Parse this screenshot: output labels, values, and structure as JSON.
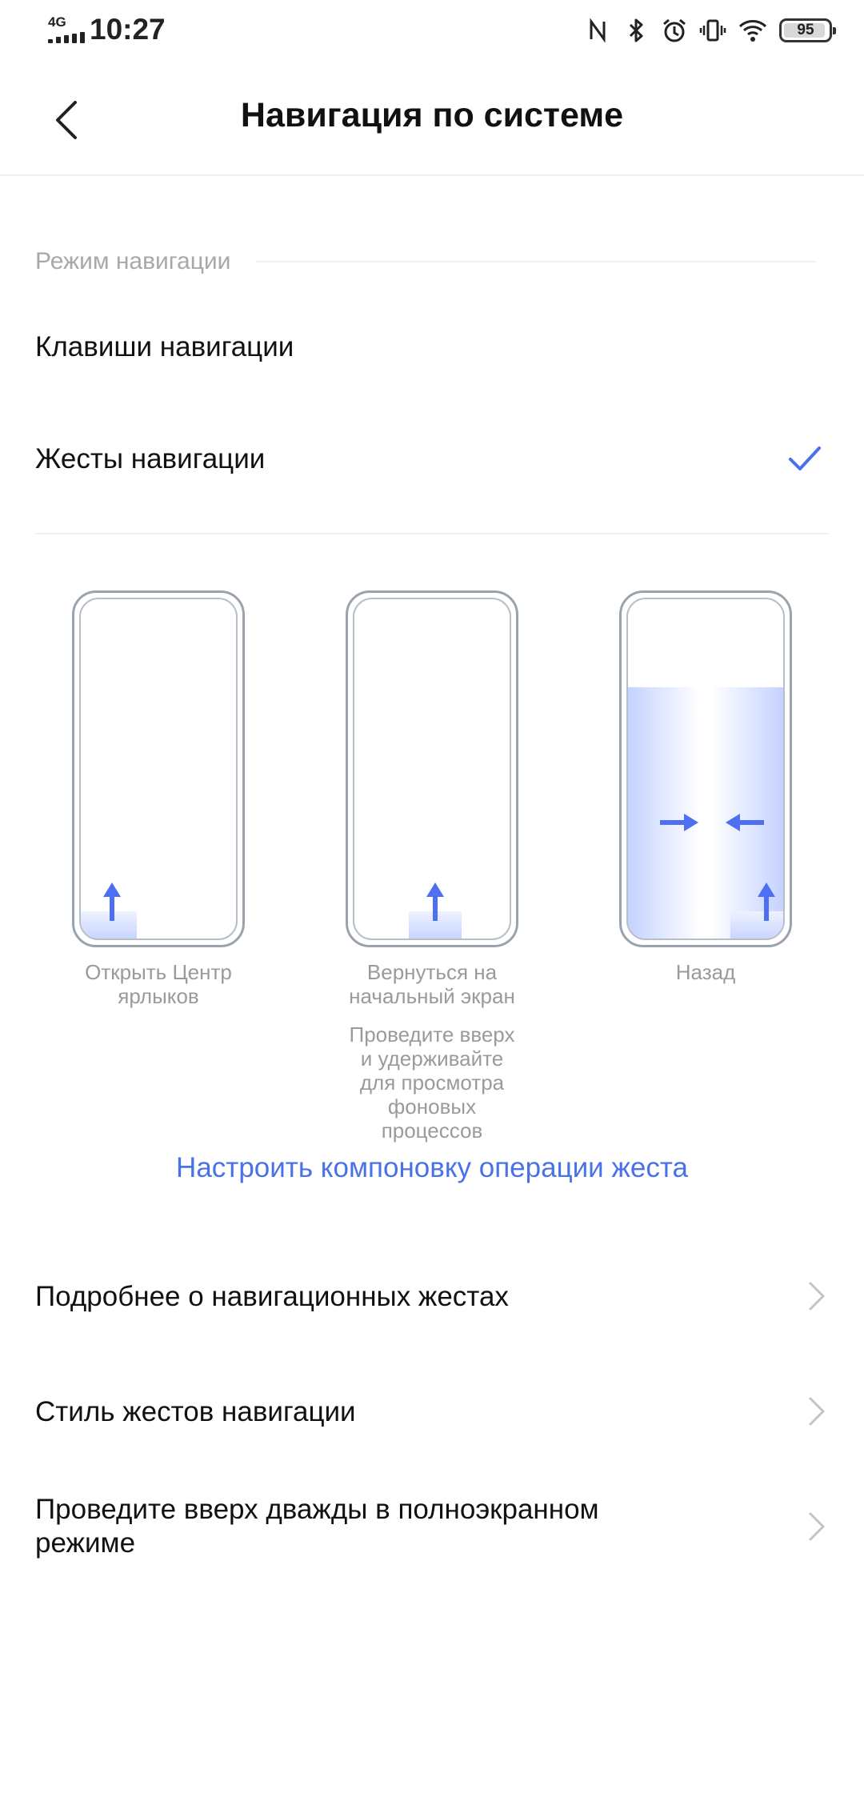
{
  "status_bar": {
    "network": "4G",
    "time": "10:27",
    "battery": "95",
    "icons": [
      "nfc-icon",
      "bluetooth-icon",
      "alarm-icon",
      "vibrate-icon",
      "wifi-icon",
      "battery-icon"
    ]
  },
  "header": {
    "title": "Навигация по системе",
    "back_icon": "chevron-left-icon"
  },
  "section": {
    "label": "Режим навигации"
  },
  "options": [
    {
      "label": "Клавиши навигации",
      "selected": false
    },
    {
      "label": "Жесты навигации",
      "selected": true
    }
  ],
  "gestures": [
    {
      "caption": "Открыть Центр ярлыков",
      "note": ""
    },
    {
      "caption": "Вернуться на начальный экран",
      "note": "Проведите вверх и удерживайте для просмотра фоновых процессов"
    },
    {
      "caption": "Назад",
      "note": ""
    }
  ],
  "link": "Настроить компоновку операции жеста",
  "menu": [
    {
      "label": "Подробнее о навигационных жестах"
    },
    {
      "label": "Стиль жестов навигации"
    },
    {
      "label": "Проведите вверх дважды в полноэкранном режиме"
    }
  ],
  "colors": {
    "accent": "#4a72e8",
    "gesture_arrow": "#4f6ff2",
    "secondary_text": "#a8a8a8"
  }
}
